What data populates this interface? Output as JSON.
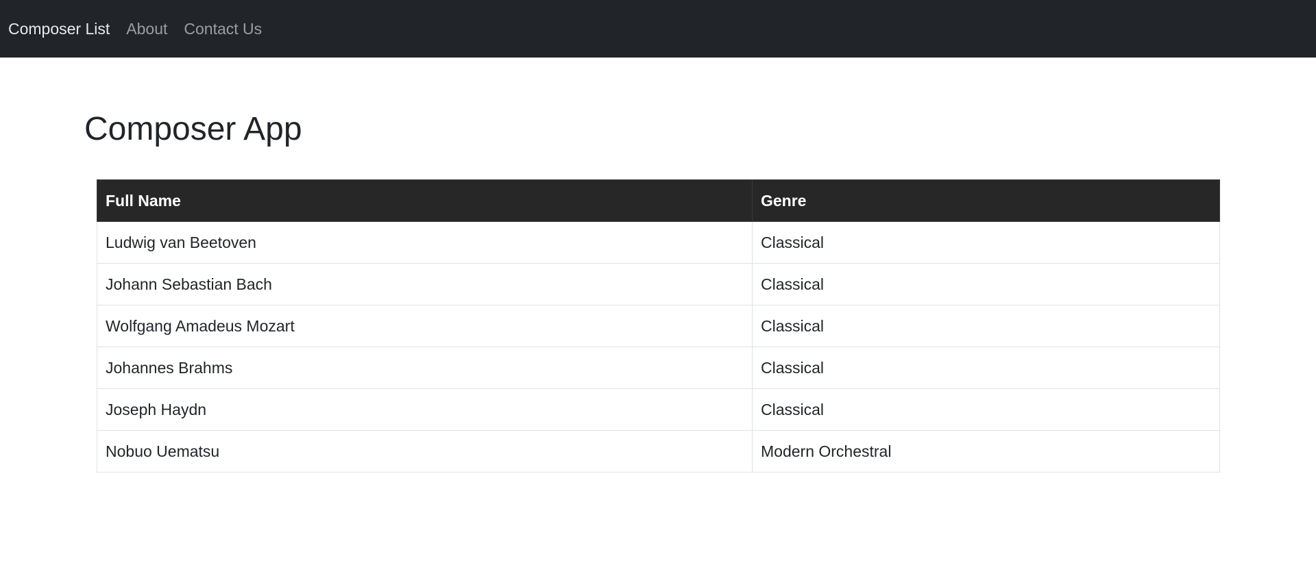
{
  "nav": {
    "items": [
      {
        "label": "Composer List",
        "name": "nav-link-composer-list"
      },
      {
        "label": "About",
        "name": "nav-link-about"
      },
      {
        "label": "Contact Us",
        "name": "nav-link-contact-us"
      }
    ]
  },
  "page": {
    "title": "Composer App"
  },
  "table": {
    "headers": [
      "Full Name",
      "Genre"
    ],
    "rows": [
      {
        "full_name": "Ludwig van Beetoven",
        "genre": "Classical"
      },
      {
        "full_name": "Johann Sebastian Bach",
        "genre": "Classical"
      },
      {
        "full_name": "Wolfgang Amadeus Mozart",
        "genre": "Classical"
      },
      {
        "full_name": "Johannes Brahms",
        "genre": "Classical"
      },
      {
        "full_name": "Joseph Haydn",
        "genre": "Classical"
      },
      {
        "full_name": "Nobuo Uematsu",
        "genre": "Modern Orchestral"
      }
    ]
  },
  "colors": {
    "navbar_bg": "#212529",
    "table_header_bg": "#272727",
    "text": "#212529"
  }
}
